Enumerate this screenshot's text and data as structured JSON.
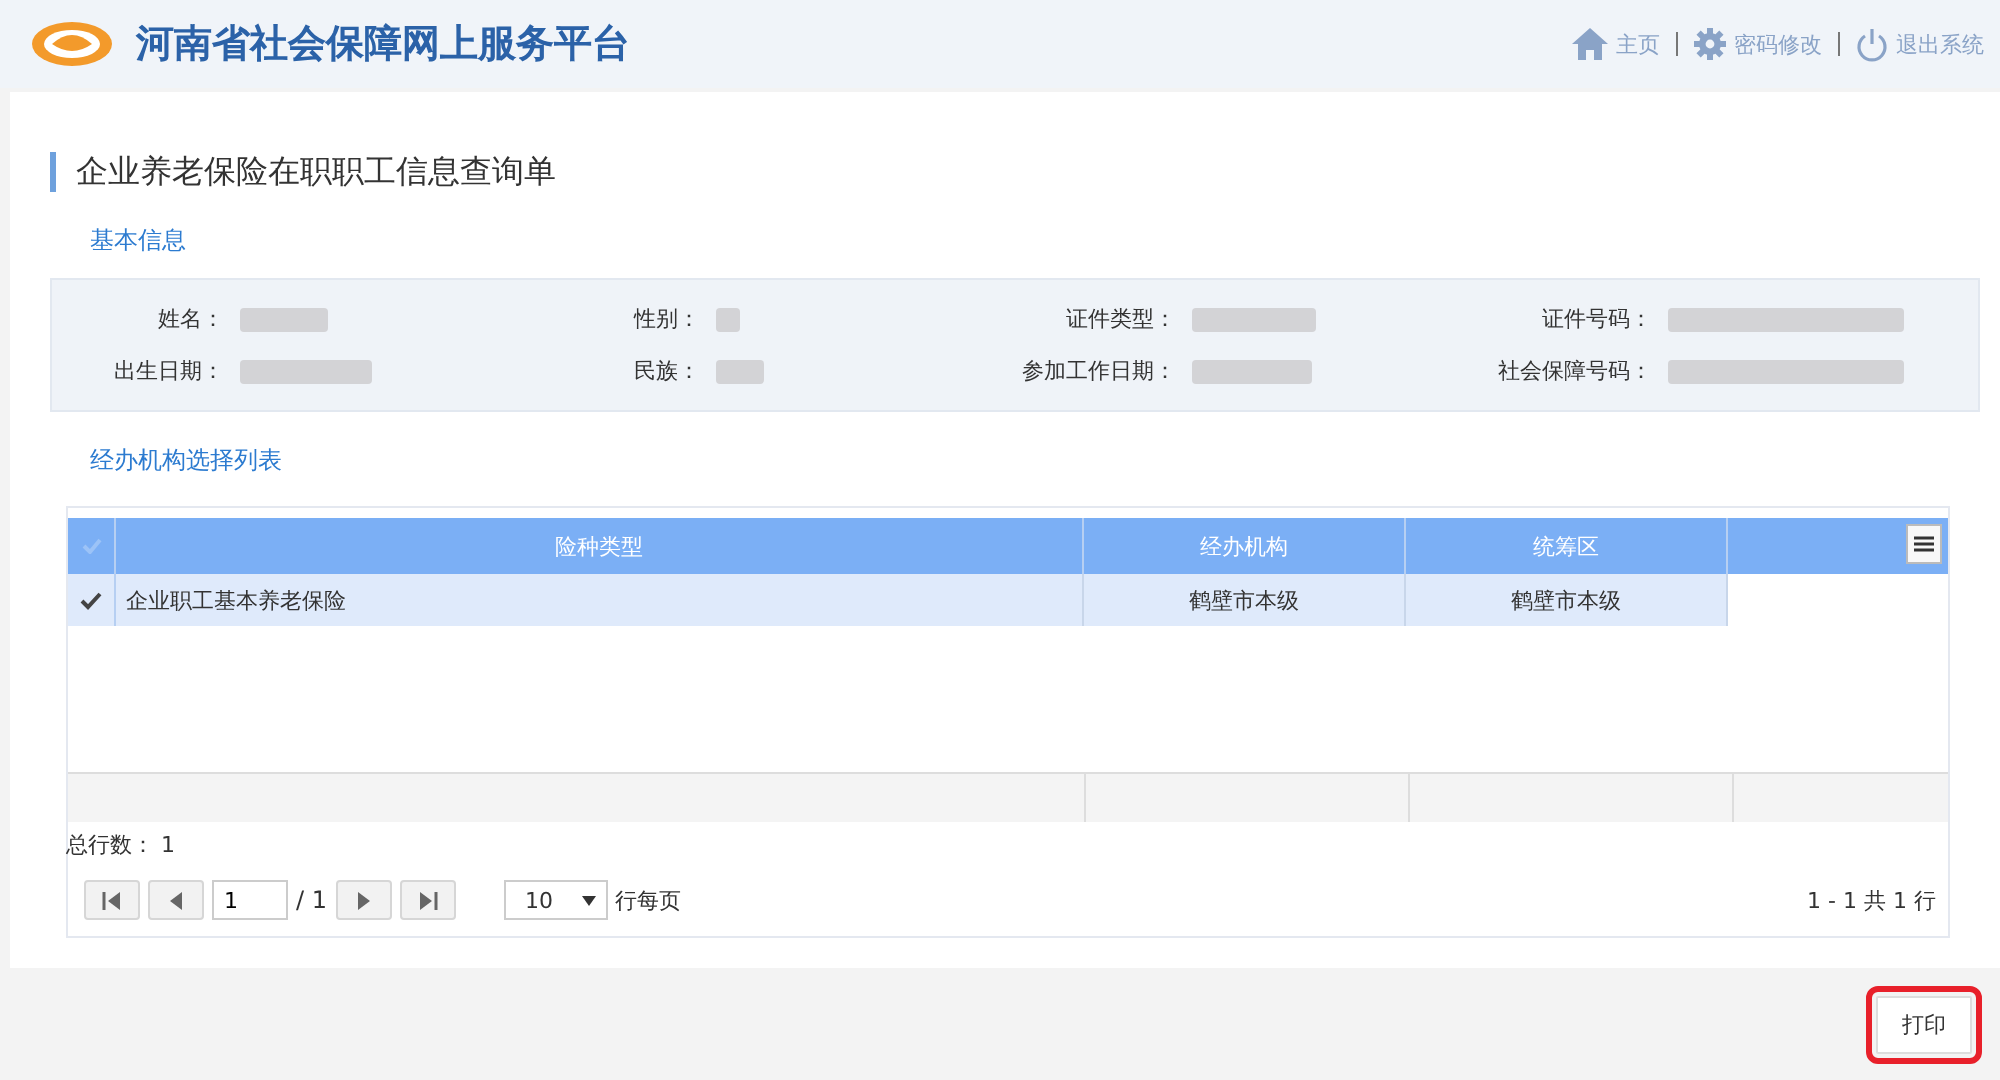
{
  "header": {
    "site_title": "河南省社会保障网上服务平台",
    "nav": [
      {
        "kind": "home",
        "label": "主页"
      },
      {
        "kind": "settings",
        "label": "密码修改"
      },
      {
        "kind": "power",
        "label": "退出系统"
      }
    ]
  },
  "page_title": "企业养老保险在职职工信息查询单",
  "basic_info": {
    "heading": "基本信息",
    "fields": [
      {
        "label": "姓名："
      },
      {
        "label": "性别："
      },
      {
        "label": "证件类型："
      },
      {
        "label": "证件号码："
      },
      {
        "label": "出生日期："
      },
      {
        "label": "民族："
      },
      {
        "label": "参加工作日期："
      },
      {
        "label": "社会保障号码："
      }
    ]
  },
  "agency_list": {
    "heading": "经办机构选择列表",
    "columns": [
      "险种类型",
      "经办机构",
      "统筹区"
    ],
    "all_checked": false,
    "rows": [
      {
        "cells": [
          "企业职工基本养老保险",
          "鹤壁市本级",
          "鹤壁市本级"
        ],
        "selected": true
      }
    ],
    "total": "总行数： 1",
    "pager": {
      "page": "1",
      "of": "/ 1",
      "page_size": "10",
      "per_page_label": "行每页",
      "summary": "1 - 1 共 1 行"
    }
  },
  "print_button": {
    "label": "打印",
    "highlighted": true
  }
}
